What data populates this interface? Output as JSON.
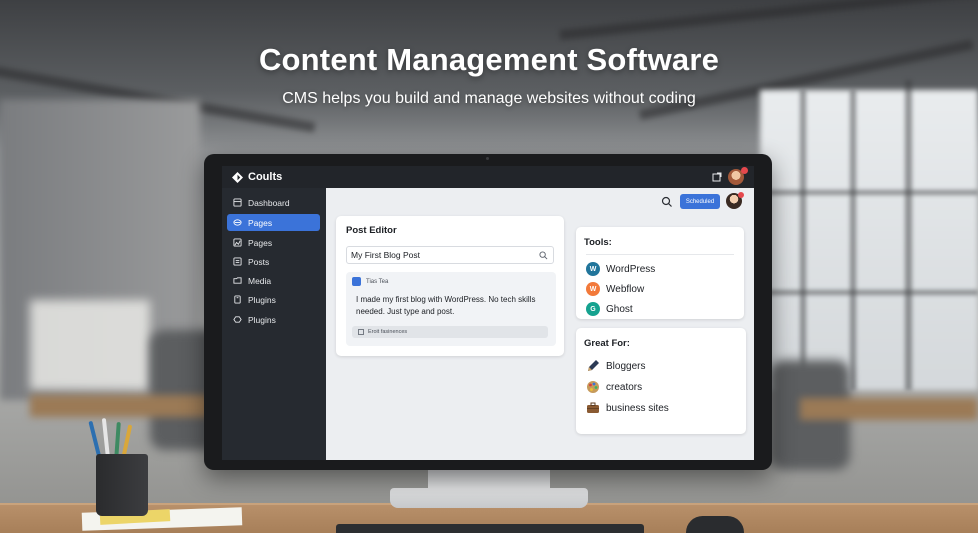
{
  "hero": {
    "title": "Content Management Software",
    "subtitle": "CMS helps you build and manage websites without coding"
  },
  "app": {
    "brand": "Coults",
    "sidebar": [
      {
        "label": "Dashboard",
        "icon": "dashboard-icon",
        "active": false
      },
      {
        "label": "Pages",
        "icon": "pages-icon",
        "active": true
      },
      {
        "label": "Pages",
        "icon": "pages-icon",
        "active": false
      },
      {
        "label": "Posts",
        "icon": "posts-icon",
        "active": false
      },
      {
        "label": "Media",
        "icon": "media-icon",
        "active": false
      },
      {
        "label": "Plugins",
        "icon": "plugins-icon",
        "active": false
      },
      {
        "label": "Plugins",
        "icon": "plugins-icon",
        "active": false
      }
    ],
    "header": {
      "primary_button": "Scheduled"
    },
    "editor": {
      "title": "Post Editor",
      "post_title_value": "My First Blog Post",
      "author": "Tias Tea",
      "body": "I made my first blog with WordPress. No tech skills needed. Just type and post.",
      "footer": "Eroit fasinences"
    },
    "tools": {
      "title": "Tools:",
      "items": [
        {
          "label": "WordPress",
          "color": "#21759b"
        },
        {
          "label": "Webflow",
          "color": "#f2793a"
        },
        {
          "label": "Ghost",
          "color": "#15a28f"
        }
      ]
    },
    "great_for": {
      "title": "Great For:",
      "items": [
        {
          "label": "Bloggers",
          "icon": "pen-icon"
        },
        {
          "label": "creators",
          "icon": "palette-icon"
        },
        {
          "label": "business sites",
          "icon": "briefcase-icon"
        }
      ]
    },
    "colors": {
      "accent": "#3b73d9",
      "sidebar_bg": "#262a30",
      "notification": "#e5484d"
    }
  }
}
